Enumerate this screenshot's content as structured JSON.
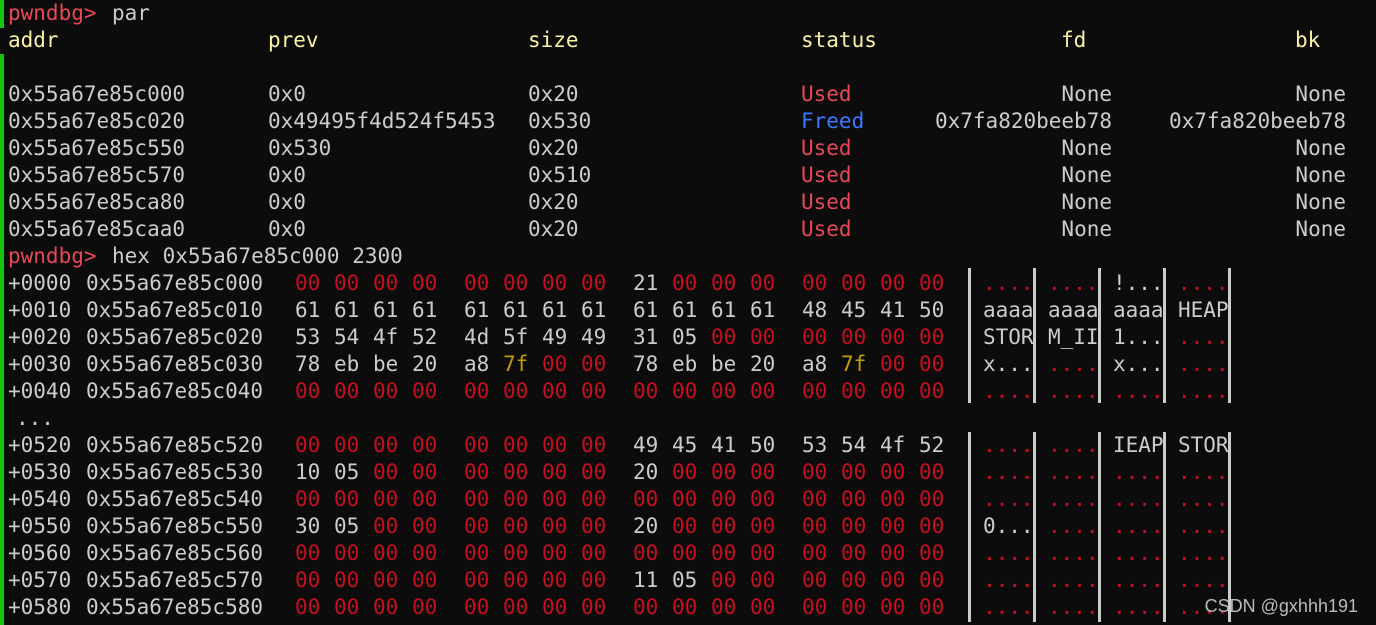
{
  "prompt": "pwndbg>",
  "cmd1": "par",
  "headers": [
    "addr",
    "prev",
    "size",
    "status",
    "fd",
    "bk"
  ],
  "chunks": [
    {
      "addr": "0x55a67e85c000",
      "prev": "0x0",
      "size": "0x20",
      "status": "Used",
      "fd": "None",
      "bk": "None"
    },
    {
      "addr": "0x55a67e85c020",
      "prev": "0x49495f4d524f5453",
      "size": "0x530",
      "status": "Freed",
      "fd": "0x7fa820beeb78",
      "bk": "0x7fa820beeb78"
    },
    {
      "addr": "0x55a67e85c550",
      "prev": "0x530",
      "size": "0x20",
      "status": "Used",
      "fd": "None",
      "bk": "None"
    },
    {
      "addr": "0x55a67e85c570",
      "prev": "0x0",
      "size": "0x510",
      "status": "Used",
      "fd": "None",
      "bk": "None"
    },
    {
      "addr": "0x55a67e85ca80",
      "prev": "0x0",
      "size": "0x20",
      "status": "Used",
      "fd": "None",
      "bk": "None"
    },
    {
      "addr": "0x55a67e85caa0",
      "prev": "0x0",
      "size": "0x20",
      "status": "Used",
      "fd": "None",
      "bk": "None"
    }
  ],
  "cmd2": "hex 0x55a67e85c000 2300",
  "ellipsis": "...",
  "hex_rows": [
    {
      "off": "+0000",
      "addr": "0x55a67e85c000",
      "bytes": [
        "00",
        "00",
        "00",
        "00",
        "00",
        "00",
        "00",
        "00",
        "21",
        "00",
        "00",
        "00",
        "00",
        "00",
        "00",
        "00"
      ],
      "ascii": [
        "....",
        "....",
        "!...",
        "...."
      ]
    },
    {
      "off": "+0010",
      "addr": "0x55a67e85c010",
      "bytes": [
        "61",
        "61",
        "61",
        "61",
        "61",
        "61",
        "61",
        "61",
        "61",
        "61",
        "61",
        "61",
        "48",
        "45",
        "41",
        "50"
      ],
      "ascii": [
        "aaaa",
        "aaaa",
        "aaaa",
        "HEAP"
      ]
    },
    {
      "off": "+0020",
      "addr": "0x55a67e85c020",
      "bytes": [
        "53",
        "54",
        "4f",
        "52",
        "4d",
        "5f",
        "49",
        "49",
        "31",
        "05",
        "00",
        "00",
        "00",
        "00",
        "00",
        "00"
      ],
      "ascii": [
        "STOR",
        "M_II",
        "1...",
        "...."
      ]
    },
    {
      "off": "+0030",
      "addr": "0x55a67e85c030",
      "bytes": [
        "78",
        "eb",
        "be",
        "20",
        "a8",
        "7f",
        "00",
        "00",
        "78",
        "eb",
        "be",
        "20",
        "a8",
        "7f",
        "00",
        "00"
      ],
      "ascii": [
        "x...",
        "....",
        "x...",
        "...."
      ]
    },
    {
      "off": "+0040",
      "addr": "0x55a67e85c040",
      "bytes": [
        "00",
        "00",
        "00",
        "00",
        "00",
        "00",
        "00",
        "00",
        "00",
        "00",
        "00",
        "00",
        "00",
        "00",
        "00",
        "00"
      ],
      "ascii": [
        "....",
        "....",
        "....",
        "...."
      ]
    },
    {
      "off": "+0520",
      "addr": "0x55a67e85c520",
      "bytes": [
        "00",
        "00",
        "00",
        "00",
        "00",
        "00",
        "00",
        "00",
        "49",
        "45",
        "41",
        "50",
        "53",
        "54",
        "4f",
        "52"
      ],
      "ascii": [
        "....",
        "....",
        "IEAP",
        "STOR"
      ]
    },
    {
      "off": "+0530",
      "addr": "0x55a67e85c530",
      "bytes": [
        "10",
        "05",
        "00",
        "00",
        "00",
        "00",
        "00",
        "00",
        "20",
        "00",
        "00",
        "00",
        "00",
        "00",
        "00",
        "00"
      ],
      "ascii": [
        "....",
        "....",
        "....",
        "...."
      ]
    },
    {
      "off": "+0540",
      "addr": "0x55a67e85c540",
      "bytes": [
        "00",
        "00",
        "00",
        "00",
        "00",
        "00",
        "00",
        "00",
        "00",
        "00",
        "00",
        "00",
        "00",
        "00",
        "00",
        "00"
      ],
      "ascii": [
        "....",
        "....",
        "....",
        "...."
      ]
    },
    {
      "off": "+0550",
      "addr": "0x55a67e85c550",
      "bytes": [
        "30",
        "05",
        "00",
        "00",
        "00",
        "00",
        "00",
        "00",
        "20",
        "00",
        "00",
        "00",
        "00",
        "00",
        "00",
        "00"
      ],
      "ascii": [
        "0...",
        "....",
        "....",
        "...."
      ]
    },
    {
      "off": "+0560",
      "addr": "0x55a67e85c560",
      "bytes": [
        "00",
        "00",
        "00",
        "00",
        "00",
        "00",
        "00",
        "00",
        "00",
        "00",
        "00",
        "00",
        "00",
        "00",
        "00",
        "00"
      ],
      "ascii": [
        "....",
        "....",
        "....",
        "...."
      ]
    },
    {
      "off": "+0570",
      "addr": "0x55a67e85c570",
      "bytes": [
        "00",
        "00",
        "00",
        "00",
        "00",
        "00",
        "00",
        "00",
        "11",
        "05",
        "00",
        "00",
        "00",
        "00",
        "00",
        "00"
      ],
      "ascii": [
        "....",
        "....",
        "....",
        "...."
      ]
    },
    {
      "off": "+0580",
      "addr": "0x55a67e85c580",
      "bytes": [
        "00",
        "00",
        "00",
        "00",
        "00",
        "00",
        "00",
        "00",
        "00",
        "00",
        "00",
        "00",
        "00",
        "00",
        "00",
        "00"
      ],
      "ascii": [
        "....",
        "....",
        "....",
        "...."
      ]
    }
  ],
  "watermark": "CSDN @gxhhh191",
  "colors": {
    "prompt": "#e74856",
    "used": "#e74856",
    "freed": "#3b78ff",
    "zero_byte": "#c50f1f",
    "ptr_byte": "#c19c00",
    "header": "#f9f1a5"
  }
}
